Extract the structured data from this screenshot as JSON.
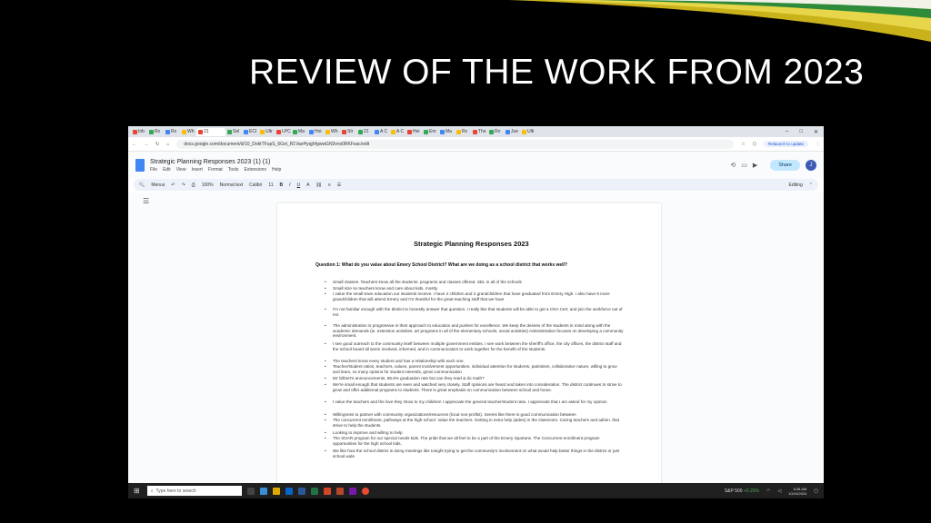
{
  "slide": {
    "title": "REVIEW OF THE WORK FROM 2023"
  },
  "browser": {
    "tabs": [
      "Inb",
      "Rx",
      "Rx",
      "Wh",
      "21",
      "Sel",
      "ECI",
      "Ultr",
      "LPC",
      "Ma",
      "Hoi",
      "Wh",
      "Str",
      "21",
      "A C",
      "A C",
      "Hei",
      "Em",
      "Ma",
      "Rx",
      "The",
      "Ro",
      "Jue",
      "Ulti"
    ],
    "active_tab_index": 4,
    "url": "docs.google.com/document/d/10_DoktTFupS_6Gxt_R1VaeHyqjIrfgwwGN3vnx0RKFsac/edit",
    "relaunch": "Relaunch to update"
  },
  "doc": {
    "title": "Strategic Planning Responses 2023 (1) (1)",
    "menu": [
      "File",
      "Edit",
      "View",
      "Insert",
      "Format",
      "Tools",
      "Extensions",
      "Help"
    ],
    "share": "Share",
    "avatar": "J",
    "toolbar": {
      "menus": "Menus",
      "zoom": "100%",
      "style": "Normal text",
      "font": "Calibri",
      "size": "11",
      "editing": "Editing"
    },
    "page_title": "Strategic Planning Responses 2023",
    "question": "Question 1: What do you value about Emery School District? What are we doing as a school district that works well?",
    "responses": [
      "Small classes. Teachers know all the students. programs and classes offered. SEL in all of the schools",
      "Small size so teachers know and care about kids, mostly",
      "I value the small-town education our students receive. I have 4 children and 2 grandchildren that have graduated from Emery High. I also have 6 more grandchildren that will attend Emery and I'm thankful for the great teaching staff that we have",
      "I'm not familiar enough with the district to honestly answer that question. I really like that students will be able to get a CNA Cert. and join the workforce out of HS",
      "The administration is progressive in their approach to education and pushes for excellence. We keep the desires of the students in mind along with the academic demands (ie. extension activities, art programs in all of the elementary schools, social activities) Administration focuses on developing a community environment.",
      "I see good outreach to the community itself between multiple government entities. I see work between the sheriff's office, the city offices, the district staff and the school board all seem involved, informed, and in communication to work together for the benefit of the students.",
      "The teachers know every student and has a relationship with each one.",
      "Teacher/student ratios, teachers, values, parent involvement opportunities, individual attention for students, patriotism, collaborative nature, willing to grow and learn, so many options for student interests, great communication",
      "Mr Gilbert's announcements. 85.6% graduation rate but can they read & do math?",
      "We're small enough that students are seen and watched very closely. Staff opinions are heard and taken into consideration. The district continues to strive to grow and offer additional programs to students. There is great emphasis on communication between school and home.",
      "I value the teachers and the love they show to my children! I appreciate the general teacher/student ratio. I appreciate that I am asked for my opinion",
      "Willingness to partner with community organizations/resources (local non-profits). Seems like there is good communication between",
      "The concurrent enrollment, pathways at the high school. Value the teachers. Getting in extra help (aides) in the classroom. Caring teachers and admin. that strive to help the students.",
      "Looking to improve and willing to help",
      "The SOAR program for our special needs kids. The pride that we all feel to be a part of the Emery Spartans. The Concurrent enrollment program opportunities for the high school kids.",
      "We like how the school district is doing meetings like tonight trying to get the community's involvement on what would help better things in the district or just school wide"
    ]
  },
  "taskbar": {
    "search": "Type here to search",
    "stock": "S&P 500",
    "stock_change": "+0.20%",
    "time": "8:38 AM",
    "date": "10/24/2024"
  }
}
